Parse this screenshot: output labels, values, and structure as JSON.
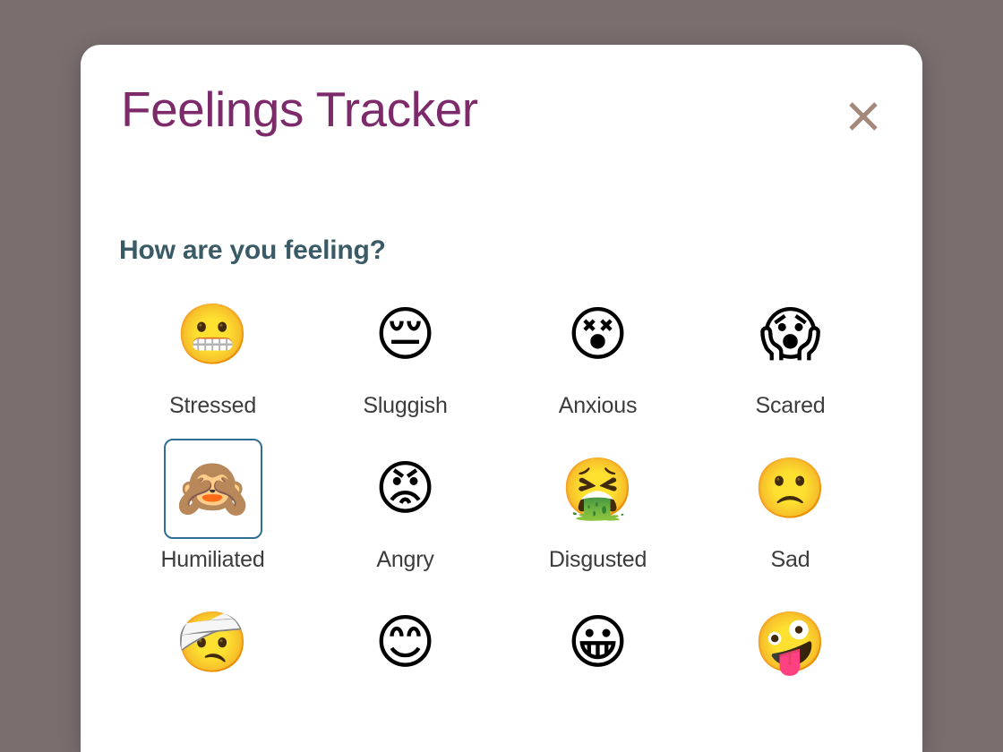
{
  "scrim": {
    "color": "#7a6e6f"
  },
  "dialog": {
    "title": "Feelings Tracker",
    "title_color": "#7d2a6b",
    "subtitle": "How are you feeling?",
    "subtitle_color": "#3a5a66",
    "background": "#ffffff",
    "close_icon": "close-icon",
    "close_icon_color": "#a4897a"
  },
  "selection": {
    "selected_label": "Humiliated",
    "selected_index": 4,
    "highlight_color": "#2f6f96"
  },
  "grid": {
    "columns": 4,
    "label_color": "#3c3c3c",
    "items": [
      {
        "label": "Stressed",
        "emoji": "😬",
        "icon_name": "grimacing-face-emoji",
        "selected": false
      },
      {
        "label": "Sluggish",
        "emoji": "😔",
        "icon_name": "pensive-face-emoji",
        "selected": false
      },
      {
        "label": "Anxious",
        "emoji": "😵",
        "icon_name": "spiral-eyes-face-emoji",
        "selected": false
      },
      {
        "label": "Scared",
        "emoji": "😱",
        "icon_name": "screaming-in-fear-face-emoji",
        "selected": false
      },
      {
        "label": "Humiliated",
        "emoji": "🙈",
        "icon_name": "face-covered-hands-emoji",
        "selected": true
      },
      {
        "label": "Angry",
        "emoji": "😡",
        "icon_name": "pouting-face-emoji",
        "selected": false
      },
      {
        "label": "Disgusted",
        "emoji": "🤮",
        "icon_name": "face-vomiting-emoji",
        "selected": false
      },
      {
        "label": "Sad",
        "emoji": "🙁",
        "icon_name": "frowning-face-emoji",
        "selected": false
      },
      {
        "label": "",
        "emoji": "🤕",
        "icon_name": "head-bandage-face-emoji",
        "selected": false
      },
      {
        "label": "",
        "emoji": "😊",
        "icon_name": "smiling-face-smiling-eyes-emoji",
        "selected": false
      },
      {
        "label": "",
        "emoji": "😀",
        "icon_name": "grinning-face-emoji",
        "selected": false
      },
      {
        "label": "",
        "emoji": "🤪",
        "icon_name": "zany-face-tongue-emoji",
        "selected": false
      }
    ]
  }
}
